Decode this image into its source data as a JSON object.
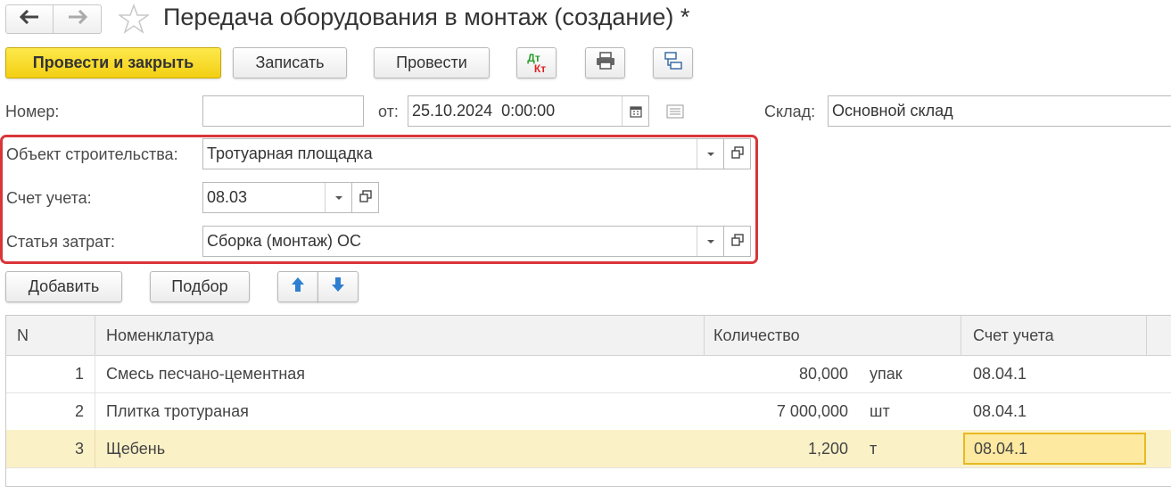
{
  "window": {
    "title": "Передача оборудования в монтаж (создание) *"
  },
  "nav": {
    "back_icon": "arrow-left-icon",
    "forward_icon": "arrow-right-icon",
    "favorite_icon": "star-icon"
  },
  "toolbar": {
    "post_close": "Провести и закрыть",
    "save": "Записать",
    "post": "Провести",
    "dtkt_dt": "Дт",
    "dtkt_kt": "Кт"
  },
  "header": {
    "number_label": "Номер:",
    "number_value": "",
    "date_label": "от:",
    "date_value": "25.10.2024  0:00:00",
    "warehouse_label": "Склад:",
    "warehouse_value": "Основной склад"
  },
  "section": {
    "object_label": "Объект строительства:",
    "object_value": "Тротуарная площадка",
    "account_label": "Счет учета:",
    "account_value": "08.03",
    "cost_label": "Статья затрат:",
    "cost_value": "Сборка (монтаж) ОС"
  },
  "table_toolbar": {
    "add": "Добавить",
    "select": "Подбор"
  },
  "table": {
    "columns": [
      "N",
      "Номенклатура",
      "Количество",
      "Счет учета"
    ],
    "rows": [
      {
        "n": "1",
        "item": "Смесь песчано-цементная",
        "qty": "80,000",
        "unit": "упак",
        "account": "08.04.1"
      },
      {
        "n": "2",
        "item": "Плитка тротураная",
        "qty": "7 000,000",
        "unit": "шт",
        "account": "08.04.1"
      },
      {
        "n": "3",
        "item": "Щебень",
        "qty": "1,200",
        "unit": "т",
        "account": "08.04.1"
      }
    ]
  },
  "colors": {
    "primary_button": "#f3cf13",
    "highlight_frame": "#d9353a",
    "selected_row": "#fbf1c7",
    "active_cell_border": "#e8b923"
  }
}
